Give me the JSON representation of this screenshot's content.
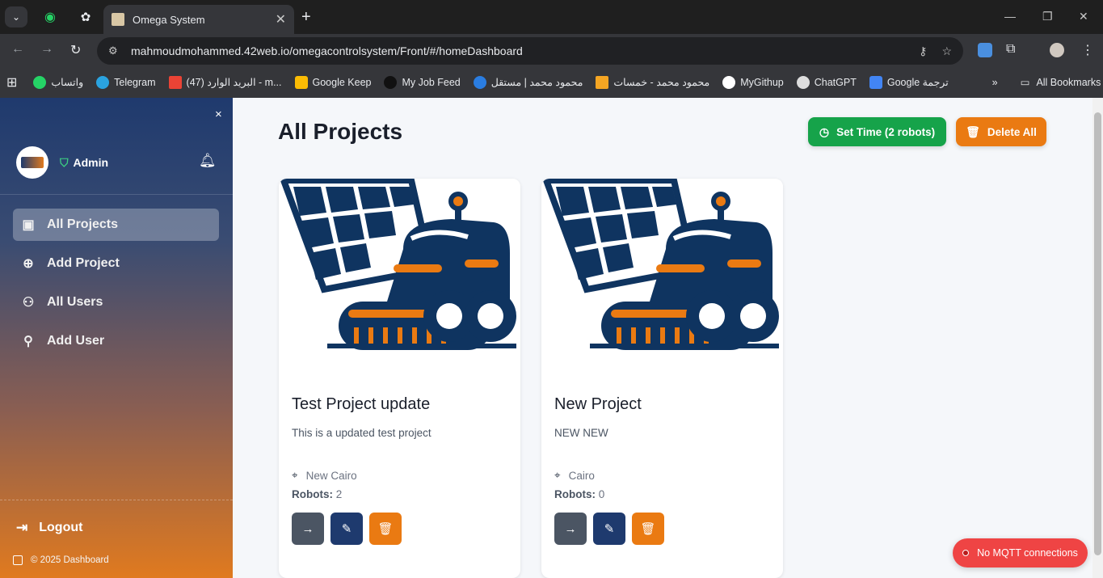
{
  "browser": {
    "tab_title": "Omega System",
    "url": "mahmoudmohammed.42web.io/omegacontrolsystem/Front/#/homeDashboard",
    "bookmarks": [
      "واتساب",
      "Telegram",
      "البريد الوارد (47) - m...",
      "Google Keep",
      "My Job Feed",
      "محمود محمد | مستقل",
      "محمود محمد - خمسات",
      "MyGithup",
      "ChatGPT",
      "Google ترجمة"
    ],
    "all_bookmarks": "All Bookmarks"
  },
  "sidebar": {
    "close": "×",
    "user_role": "Admin",
    "items": [
      {
        "label": "All Projects",
        "icon": "projects-icon"
      },
      {
        "label": "Add Project",
        "icon": "plus-circle-icon"
      },
      {
        "label": "All Users",
        "icon": "users-icon"
      },
      {
        "label": "Add User",
        "icon": "user-plus-icon"
      }
    ],
    "logout": "Logout",
    "copyright": "© 2025 Dashboard"
  },
  "main": {
    "title": "All Projects",
    "set_time_label": "Set Time (2 robots)",
    "delete_all_label": "Delete All",
    "projects": [
      {
        "title": "Test Project update",
        "description": "This is a updated test project",
        "location": "New Cairo",
        "robots_label": "Robots:",
        "robots": "2"
      },
      {
        "title": "New Project",
        "description": "NEW NEW",
        "location": "Cairo",
        "robots_label": "Robots:",
        "robots": "0"
      }
    ]
  },
  "status": {
    "mqtt": "No MQTT connections"
  },
  "colors": {
    "green": "#16a34a",
    "orange": "#ea7a12",
    "navy": "#1e3a6e",
    "red": "#ef4444"
  }
}
